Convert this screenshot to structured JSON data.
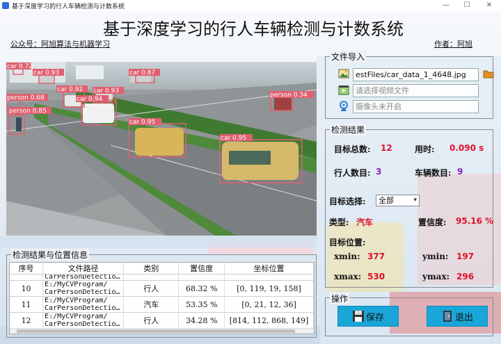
{
  "window": {
    "title": "基于深度学习的行人车辆检测与计数系统",
    "min": "—",
    "max": "☐",
    "close": "✕"
  },
  "header": {
    "title": "基于深度学习的行人车辆检测与计数系统",
    "account": "公众号：阿旭算法与机器学习",
    "author": "作者：阿旭"
  },
  "video": {
    "detections": [
      {
        "label": "car 0.72"
      },
      {
        "label": "car 0.93"
      },
      {
        "label": "car 0.87"
      },
      {
        "label": "person 0.68"
      },
      {
        "label": "person 0.85"
      },
      {
        "label": "car 0.92"
      },
      {
        "label": "car 0.93"
      },
      {
        "label": "car 0.94"
      },
      {
        "label": "car 0.95"
      },
      {
        "label": "car 0.95"
      },
      {
        "label": "person 0.34"
      }
    ]
  },
  "file_import": {
    "group_label": "文件导入",
    "image_path": "estFiles/car_data_1_4648.jpg",
    "video_placeholder": "请选择视频文件",
    "camera_placeholder": "摄像头未开启",
    "colors": {
      "accent": "#e0102a"
    }
  },
  "results": {
    "group_label": "检测结果",
    "total_label": "目标总数:",
    "total_value": "12",
    "time_label": "用时:",
    "time_value": "0.090 s",
    "person_label": "行人数目:",
    "person_value": "3",
    "vehicle_label": "车辆数目:",
    "vehicle_value": "9",
    "select_label": "目标选择:",
    "select_value": "全部",
    "type_label": "类型:",
    "type_value": "汽车",
    "conf_label": "置信度:",
    "conf_value": "95.16 %",
    "pos_label": "目标位置:",
    "xmin_label": "xmin:",
    "xmin_value": "377",
    "ymin_label": "ymin:",
    "ymin_value": "197",
    "xmax_label": "xmax:",
    "xmax_value": "530",
    "ymax_label": "ymax:",
    "ymax_value": "296"
  },
  "ops": {
    "group_label": "操作",
    "save": "保存",
    "exit": "退出"
  },
  "table": {
    "group_label": "检测结果与位置信息",
    "headers": [
      "序号",
      "文件路径",
      "类别",
      "置信度",
      "坐标位置"
    ],
    "rows": [
      {
        "idx": "10",
        "path1": "E:/MyCVProgram/",
        "path2": "CarPersonDetectio…",
        "cls": "行人",
        "conf": "68.32 %",
        "pos": "[0, 119, 19, 158]"
      },
      {
        "idx": "11",
        "path1": "E:/MyCVProgram/",
        "path2": "CarPersonDetectio…",
        "cls": "汽车",
        "conf": "53.35 %",
        "pos": "[0, 21, 12, 36]"
      },
      {
        "idx": "12",
        "path1": "E:/MyCVProgram/",
        "path2": "CarPersonDetectio…",
        "cls": "行人",
        "conf": "34.28 %",
        "pos": "[814, 112, 868, 149]"
      }
    ],
    "partial_top_path": "CarPersonDetectio…"
  }
}
